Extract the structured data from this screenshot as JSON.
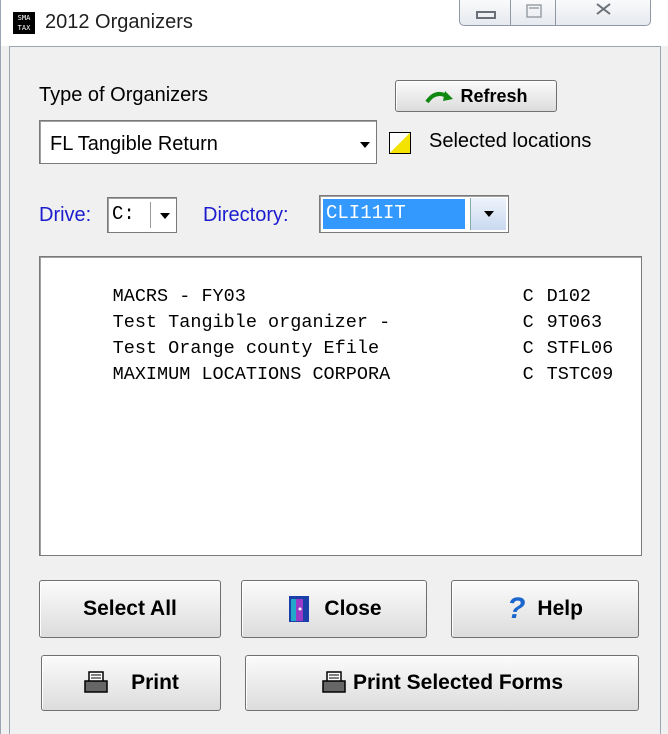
{
  "window": {
    "title": "2012 Organizers",
    "app_icon_text": "SMA TAX",
    "min_glyph": "—",
    "max_glyph": "□",
    "close_glyph": "✕"
  },
  "organizer_type": {
    "label": "Type of Organizers",
    "selected": "FL Tangible Return"
  },
  "refresh_button": {
    "label": "Refresh"
  },
  "selected_locations": {
    "label": "Selected locations",
    "checked": "partial"
  },
  "drive": {
    "label": "Drive:",
    "value": "C:"
  },
  "directory": {
    "label": "Directory:",
    "value": "CLI11IT"
  },
  "organizers_list": [
    {
      "name": "MACRS - FY03",
      "drive": "C",
      "code": "D102"
    },
    {
      "name": "Test Tangible organizer -",
      "drive": "C",
      "code": "9T063"
    },
    {
      "name": "Test Orange county Efile",
      "drive": "C",
      "code": "STFL06"
    },
    {
      "name": "MAXIMUM LOCATIONS CORPORA",
      "drive": "C",
      "code": "TSTC09"
    }
  ],
  "buttons": {
    "select_all": "Select All",
    "close": "Close",
    "help": "Help",
    "print": "Print",
    "print_selected": "Print Selected Forms"
  },
  "colors": {
    "label_blue": "#1c1ccf",
    "selection_bg": "#3399ff",
    "checkbox_fill": "#f4e200",
    "refresh_arrow": "#118811",
    "help_icon": "#1a66cc"
  }
}
